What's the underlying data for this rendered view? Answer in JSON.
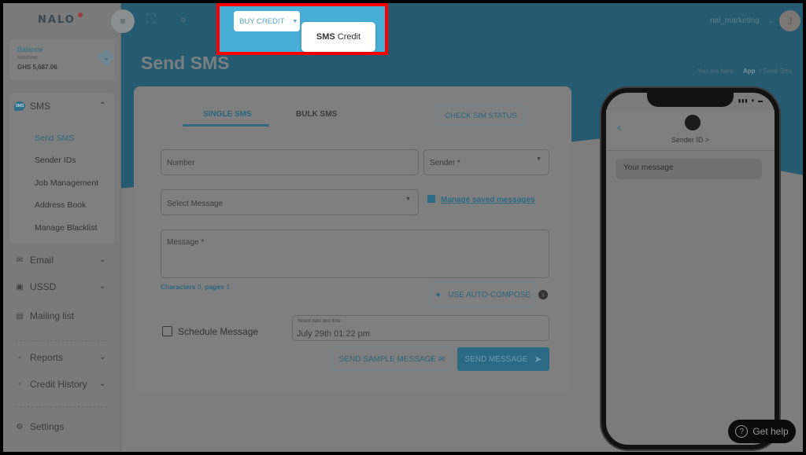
{
  "app": {
    "logo": "NALO"
  },
  "balance": {
    "label": "Balance",
    "sub_label": "SMS/EMAIL",
    "value": "GHS 5,687.06"
  },
  "sidebar": {
    "sms": {
      "label": "SMS",
      "sub_items": [
        "Send SMS",
        "Sender IDs",
        "Job Management",
        "Address Book",
        "Manage Blacklist"
      ],
      "active": "Send SMS"
    },
    "items": [
      {
        "label": "Email",
        "icon": "envelope-icon",
        "has_chevron": true
      },
      {
        "label": "USSD",
        "icon": "ussd-icon",
        "has_chevron": true
      },
      {
        "label": "Mailing list",
        "icon": "contact-card-icon",
        "has_chevron": false
      },
      {
        "label": "Reports",
        "icon": "report-icon",
        "has_chevron": true
      },
      {
        "label": "Credit History",
        "icon": "report-icon",
        "has_chevron": true
      },
      {
        "label": "Settings",
        "icon": "gear-icon",
        "has_chevron": false
      }
    ]
  },
  "toolbar": {
    "buy_credit_label": "BUY CREDIT",
    "dropdown_item_bold": "SMS",
    "dropdown_item_rest": "Credit",
    "user_name": "nal_marketing",
    "avatar_initial": "J"
  },
  "page": {
    "title": "Send SMS",
    "breadcrumb": {
      "prefix": "You are here:",
      "app": "App",
      "separator": "/",
      "current": "Send-Sms"
    }
  },
  "form": {
    "tabs": [
      {
        "label": "SINGLE SMS",
        "active": true
      },
      {
        "label": "BULK SMS",
        "active": false
      }
    ],
    "check_sim_label": "CHECK SIM STATUS",
    "number_placeholder": "Number",
    "sender_placeholder": "Sender *",
    "select_message_placeholder": "Select Message",
    "manage_saved_label": "Manage saved messages",
    "message_placeholder": "Message *",
    "characters_label": "Characters",
    "characters_value": "0",
    "pages_label": "pages",
    "pages_value": "1",
    "auto_compose_label": "USE AUTO-COMPOSE",
    "schedule_label": "Schedule Message",
    "schedule_checked": false,
    "datetime_label": "Select date and time",
    "datetime_value": "July 29th 01:22 pm",
    "send_sample_label": "SEND SAMPLE MESSAGE",
    "send_label": "SEND MESSAGE"
  },
  "preview": {
    "sender_id": "Sender ID >",
    "message": "Your message"
  },
  "help": {
    "label": "Get help"
  },
  "colors": {
    "accent": "#2f6f8a",
    "highlight_border": "#ff0000",
    "buy_credit_bg": "#48aed6"
  }
}
